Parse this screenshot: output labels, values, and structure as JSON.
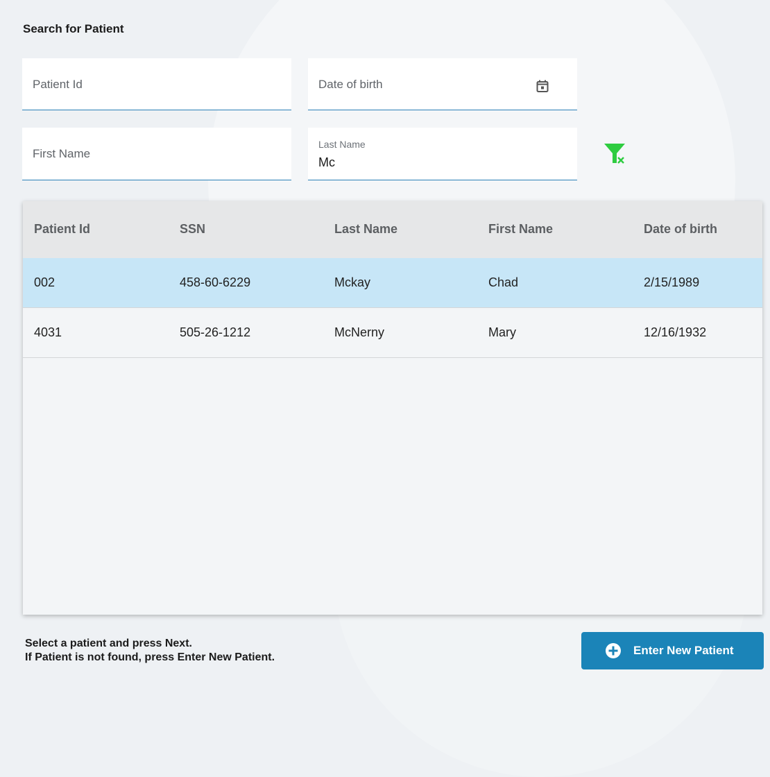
{
  "title": "Search for Patient",
  "fields": {
    "patient_id": {
      "placeholder": "Patient Id",
      "value": ""
    },
    "date_of_birth": {
      "placeholder": "Date of birth",
      "value": "",
      "icon": "calendar-icon"
    },
    "first_name": {
      "placeholder": "First Name",
      "value": ""
    },
    "last_name": {
      "label": "Last Name",
      "value": "Mc"
    }
  },
  "clear_filter_icon": "clear-filter-icon",
  "table": {
    "columns": [
      "Patient Id",
      "SSN",
      "Last Name",
      "First Name",
      "Date of birth"
    ],
    "rows": [
      {
        "patient_id": "002",
        "ssn": "458-60-6229",
        "last_name": "Mckay",
        "first_name": "Chad",
        "dob": "2/15/1989",
        "selected": true
      },
      {
        "patient_id": "4031",
        "ssn": "505-26-1212",
        "last_name": "McNerny",
        "first_name": "Mary",
        "dob": "12/16/1932",
        "selected": false
      }
    ]
  },
  "footer": {
    "line1": "Select a patient and press Next.",
    "line2": "If Patient is not found, press Enter New Patient.",
    "new_patient_button": "Enter New Patient"
  },
  "colors": {
    "accent": "#1b84b8",
    "selected_row": "#c7e6f7",
    "filter_icon": "#2ecc40"
  }
}
